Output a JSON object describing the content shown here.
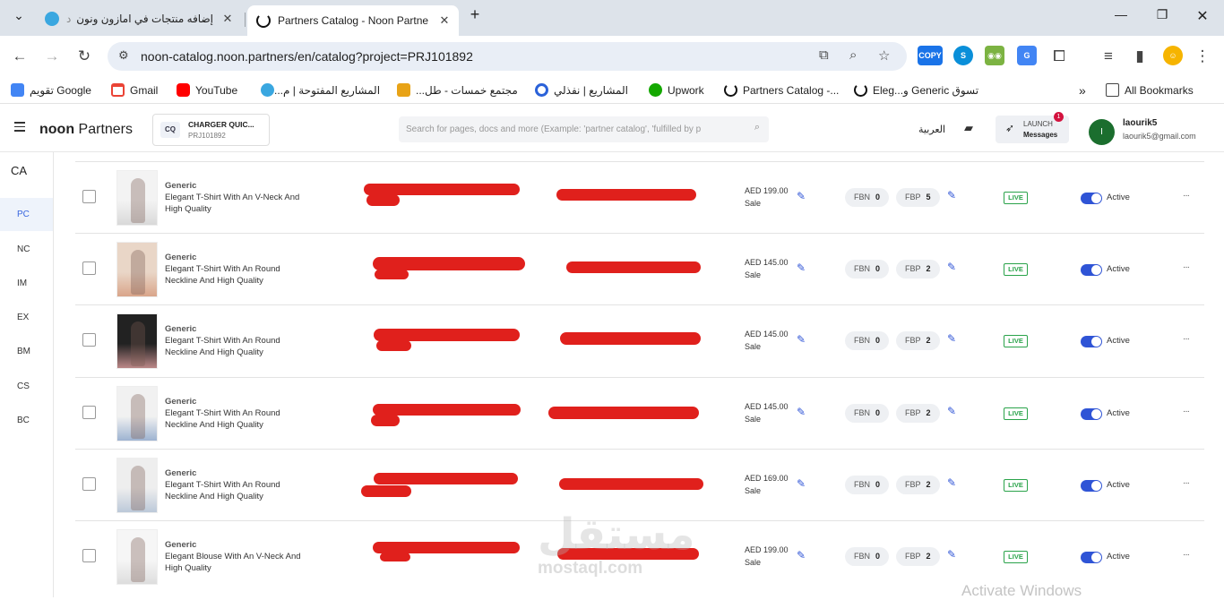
{
  "browser": {
    "tabs": [
      {
        "title": "د"
      },
      {
        "title": "إضافه منتجات في امازون ونون | م"
      },
      {
        "title": "Partners Catalog - Noon Partne"
      }
    ],
    "new_tab_label": "+",
    "url": "noon-catalog.noon.partners/en/catalog?project=PRJ101892",
    "copy_ext_label": "COPY",
    "bookmarks": [
      {
        "label": "تقويم Google"
      },
      {
        "label": "Gmail"
      },
      {
        "label": "YouTube"
      },
      {
        "label": "المشاريع المفتوحة | م..."
      },
      {
        "label": "مجتمع خمسات - طل..."
      },
      {
        "label": "المشاريع | نفذلي"
      },
      {
        "label": "Upwork"
      },
      {
        "label": "Partners Catalog -..."
      },
      {
        "label": "تسوق Generic و...Eleg"
      }
    ],
    "all_bookmarks": "All Bookmarks"
  },
  "app": {
    "brand_bold": "noon",
    "brand_rest": " Partners",
    "project": {
      "initials": "CQ",
      "name": "CHARGER QUIC...",
      "id": "PRJ101892"
    },
    "search_placeholder": "Search for pages, docs and more (Example: 'partner catalog', 'fulfilled by p",
    "language": "العربية",
    "launch": {
      "line1": "LAUNCH",
      "line2": "Messages",
      "badge": "1"
    },
    "user": {
      "initial": "I",
      "name": "laourik5",
      "email": "laourik5@gmail.com"
    }
  },
  "rail": {
    "country": "CA",
    "items": [
      "PC",
      "NC",
      "IM",
      "EX",
      "BM",
      "CS",
      "BC"
    ]
  },
  "rows": [
    {
      "brand": "Generic",
      "title": "Elegant T-Shirt With An V-Neck And High Quality",
      "price": "AED 199.00",
      "price_type": "Sale",
      "fbn_label": "FBN",
      "fbn": "0",
      "fbp_label": "FBP",
      "fbp": "5",
      "live": "LIVE",
      "status": "Active",
      "more": "···"
    },
    {
      "brand": "Generic",
      "title": "Elegant T-Shirt With An Round Neckline And High Quality",
      "price": "AED 145.00",
      "price_type": "Sale",
      "fbn_label": "FBN",
      "fbn": "0",
      "fbp_label": "FBP",
      "fbp": "2",
      "live": "LIVE",
      "status": "Active",
      "more": "···"
    },
    {
      "brand": "Generic",
      "title": "Elegant T-Shirt With An Round Neckline And High Quality",
      "price": "AED 145.00",
      "price_type": "Sale",
      "fbn_label": "FBN",
      "fbn": "0",
      "fbp_label": "FBP",
      "fbp": "2",
      "live": "LIVE",
      "status": "Active",
      "more": "···"
    },
    {
      "brand": "Generic",
      "title": "Elegant T-Shirt With An Round Neckline And High Quality",
      "price": "AED 145.00",
      "price_type": "Sale",
      "fbn_label": "FBN",
      "fbn": "0",
      "fbp_label": "FBP",
      "fbp": "2",
      "live": "LIVE",
      "status": "Active",
      "more": "···"
    },
    {
      "brand": "Generic",
      "title": "Elegant T-Shirt With An Round Neckline And High Quality",
      "price": "AED 169.00",
      "price_type": "Sale",
      "fbn_label": "FBN",
      "fbn": "0",
      "fbp_label": "FBP",
      "fbp": "2",
      "live": "LIVE",
      "status": "Active",
      "more": "···"
    },
    {
      "brand": "Generic",
      "title": "Elegant Blouse With An V-Neck And High Quality",
      "price": "AED 199.00",
      "price_type": "Sale",
      "fbn_label": "FBN",
      "fbn": "0",
      "fbp_label": "FBP",
      "fbp": "2",
      "live": "LIVE",
      "status": "Active",
      "more": "···"
    }
  ],
  "watermark": {
    "logo": "مستقل",
    "domain": "mostaql.com"
  },
  "os_watermark": "Activate Windows",
  "colors": {
    "accent": "#2f54d6",
    "live_green": "#2aa34a",
    "redaction": "#e0201c",
    "avatar": "#1b6e2e"
  }
}
